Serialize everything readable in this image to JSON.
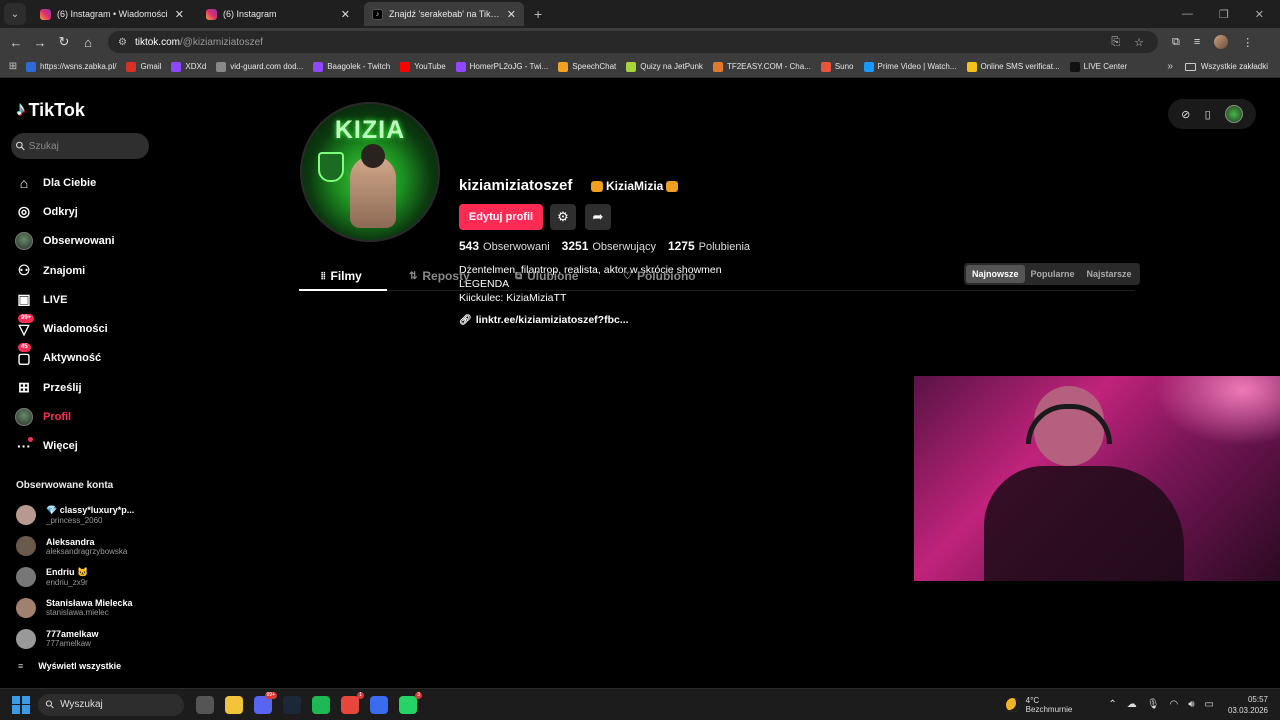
{
  "browser": {
    "tabs": [
      {
        "title": "(6) Instagram • Wiadomości",
        "favicon": "instagram-icon",
        "active": false
      },
      {
        "title": "(6) Instagram",
        "favicon": "instagram-icon",
        "active": false
      },
      {
        "title": "Znajdź 'serakebab' na TikTok | W",
        "favicon": "tiktok-icon",
        "active": true
      }
    ],
    "url_host": "tiktok.com",
    "url_path": "/@kiziamiziatoszef",
    "bookmarks": [
      {
        "label": "https://wsns.zabka.pl/",
        "color": "#2f6bd8"
      },
      {
        "label": "Gmail",
        "color": "#d93025"
      },
      {
        "label": "XDXd",
        "color": "#9146ff"
      },
      {
        "label": "vid-guard.com dod...",
        "color": "#888888"
      },
      {
        "label": "Baagolek - Twitch",
        "color": "#9146ff"
      },
      {
        "label": "YouTube",
        "color": "#ff0000"
      },
      {
        "label": "HomerPL2oJG - Twi...",
        "color": "#9146ff"
      },
      {
        "label": "SpeechChat",
        "color": "#f4a020"
      },
      {
        "label": "Quizy na JetPunk",
        "color": "#a8d43a"
      },
      {
        "label": "TF2EASY.COM - Cha...",
        "color": "#e07a2a"
      },
      {
        "label": "Suno",
        "color": "#e8553a"
      },
      {
        "label": "Prime Video | Watch...",
        "color": "#1a98ff"
      },
      {
        "label": "Online SMS verificat...",
        "color": "#f2c21b"
      },
      {
        "label": "LIVE Center",
        "color": "#111111"
      }
    ],
    "bookmarks_folder": "Wszystkie zakładki"
  },
  "sidebar": {
    "logo": "TikTok",
    "search_placeholder": "Szukaj",
    "items": [
      {
        "label": "Dla Ciebie",
        "icon": "home-icon",
        "glyph": "⌂"
      },
      {
        "label": "Odkryj",
        "icon": "compass-icon",
        "glyph": "◎"
      },
      {
        "label": "Obserwowani",
        "icon": "following-avatar-icon",
        "glyph": ""
      },
      {
        "label": "Znajomi",
        "icon": "friends-icon",
        "glyph": "⚇"
      },
      {
        "label": "LIVE",
        "icon": "live-icon",
        "glyph": "▣"
      },
      {
        "label": "Wiadomości",
        "icon": "messages-icon",
        "glyph": "▽",
        "badge": "99+"
      },
      {
        "label": "Aktywność",
        "icon": "activity-icon",
        "glyph": "▢",
        "badge": "45"
      },
      {
        "label": "Prześlij",
        "icon": "upload-icon",
        "glyph": "⊞"
      },
      {
        "label": "Profil",
        "icon": "profile-avatar-icon",
        "glyph": ""
      },
      {
        "label": "Więcej",
        "icon": "more-icon",
        "glyph": "···"
      }
    ],
    "followed_title": "Obserwowane konta",
    "followed": [
      {
        "name": "💎 classy*luxury*p...",
        "handle": "_princess_2060",
        "color": "#b89890"
      },
      {
        "name": "Aleksandra",
        "handle": "aleksandragrzybowska",
        "color": "#6b5a4c"
      },
      {
        "name": "Endriu 🐱",
        "handle": "endriu_zx9r",
        "color": "#777777"
      },
      {
        "name": "Stanisława Mielecka",
        "handle": "stanislawa.mielec",
        "color": "#a08070"
      },
      {
        "name": "777amelkaw",
        "handle": "777amelkaw",
        "color": "#999999"
      }
    ],
    "show_all": "Wyświetl wszystkie"
  },
  "profile": {
    "avatar_text": "KIZIA",
    "username": "kiziamiziatoszef",
    "nickname": "KiziaMizia",
    "edit_button": "Edytuj profil",
    "stats": [
      {
        "value": "543",
        "label": "Obserwowani"
      },
      {
        "value": "3251",
        "label": "Obserwujący"
      },
      {
        "value": "1275",
        "label": "Polubienia"
      }
    ],
    "bio": [
      "Dżentelmen, filantrop, realista, aktor w skrócie showmen",
      "LEGENDA",
      "Kiickulec: KiziaMiziaTT"
    ],
    "link": "linktr.ee/kiziamiziatoszef?fbc...",
    "tabs": [
      "Filmy",
      "Reposty",
      "Ulubione",
      "Polubiono"
    ],
    "sort": [
      "Najnowsze",
      "Popularne",
      "Najstarsze"
    ]
  },
  "taskbar": {
    "search": "Wyszukaj",
    "weather_temp": "4°C",
    "weather_desc": "Bezchmurnie",
    "time": "05:57",
    "date": "03.03.2026",
    "apps": [
      {
        "name": "task-view-icon",
        "color": "#555555"
      },
      {
        "name": "file-explorer-icon",
        "color": "#f2c33b"
      },
      {
        "name": "discord-icon",
        "color": "#5865f2",
        "badge": "99+"
      },
      {
        "name": "steam-icon",
        "color": "#1b2838"
      },
      {
        "name": "spotify-icon",
        "color": "#1db954"
      },
      {
        "name": "chrome-icon",
        "color": "#e8453c",
        "badge": "1"
      },
      {
        "name": "app-icon",
        "color": "#3a6cf0"
      },
      {
        "name": "whatsapp-icon",
        "color": "#25d366",
        "badge": "3"
      }
    ]
  }
}
